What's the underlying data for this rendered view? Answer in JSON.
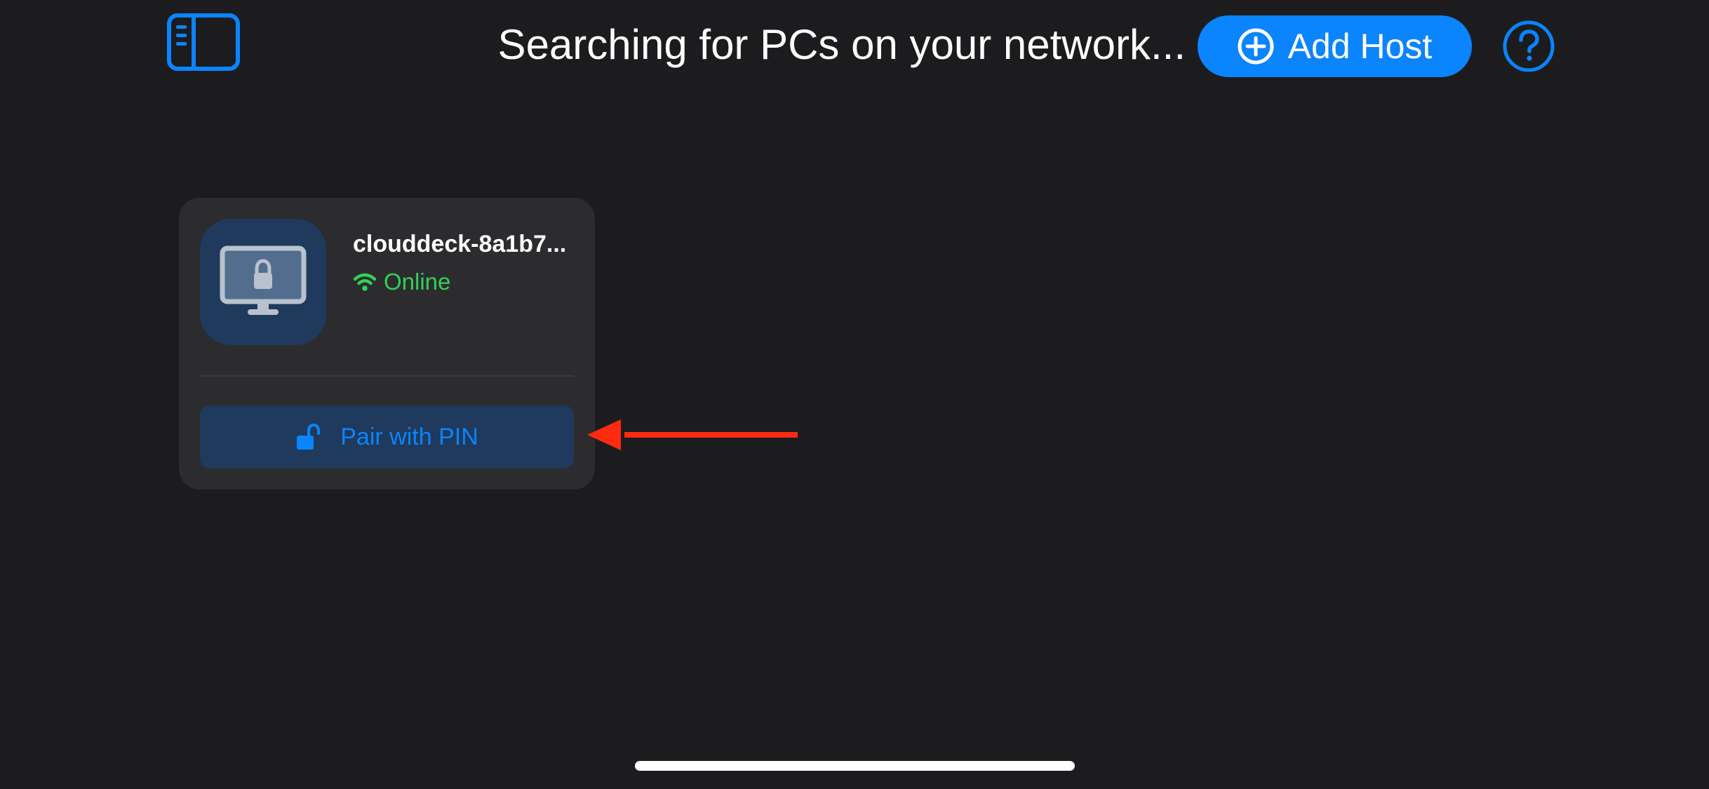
{
  "header": {
    "title": "Searching for PCs on your network...",
    "add_host_label": "Add Host",
    "sidebar_toggle_icon": "sidebar-toggle-icon",
    "add_host_icon": "plus-circle-icon",
    "help_icon": "question-circle-icon"
  },
  "host_card": {
    "name": "clouddeck-8a1b7...",
    "status": "Online",
    "status_icon": "wifi-icon",
    "host_icon": "locked-monitor-icon",
    "pair_button_label": "Pair with PIN",
    "pair_icon": "unlock-icon"
  },
  "colors": {
    "background": "#1c1c1e",
    "card": "#2c2c2e",
    "accent": "#0a84ff",
    "tile": "#1f3a5c",
    "online": "#30d158",
    "annotation": "#ff2a10"
  }
}
